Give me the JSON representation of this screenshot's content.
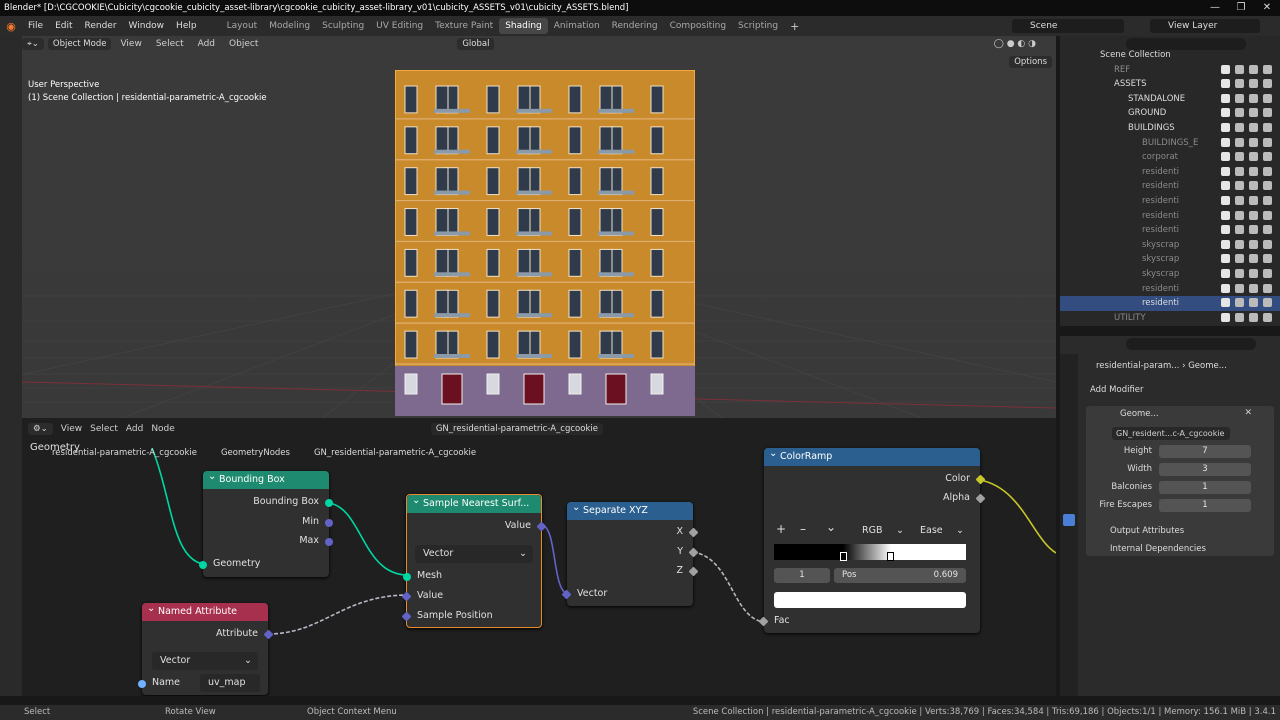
{
  "window": {
    "title": "Blender* [D:\\CGCOOKIE\\Cubicity\\cgcookie_cubicity_asset-library\\cgcookie_cubicity_asset-library_v01\\cubicity_ASSETS_v01\\cubicity_ASSETS.blend]",
    "controls": [
      "—",
      "❐",
      "✕"
    ]
  },
  "menubar": {
    "menus": [
      "File",
      "Edit",
      "Render",
      "Window",
      "Help"
    ],
    "workspaces": [
      "Layout",
      "Modeling",
      "Sculpting",
      "UV Editing",
      "Texture Paint",
      "Shading",
      "Animation",
      "Rendering",
      "Compositing",
      "Scripting"
    ],
    "active_workspace": "Shading",
    "add_tab": "+",
    "scene": "Scene",
    "view_layer": "View Layer"
  },
  "viewport": {
    "mode": "Object Mode",
    "menus": [
      "View",
      "Select",
      "Add",
      "Object"
    ],
    "transform": "Global",
    "options": "Options",
    "perspective": "User Perspective",
    "collection_info": "(1) Scene Collection | residential-parametric-A_cgcookie",
    "building": {
      "floors": 7,
      "columns": 7,
      "facade_color": "#c98a2c",
      "base_color": "#7e6a8e"
    }
  },
  "node_editor": {
    "menus": [
      "View",
      "Select",
      "Add",
      "Node"
    ],
    "node_group": "GN_residential-parametric-A_cgcookie",
    "breadcrumb": [
      "residential-parametric-A_cgcookie",
      "GeometryNodes",
      "GN_residential-parametric-A_cgcookie"
    ],
    "overlay_label": "Geometry",
    "nodes": {
      "bounding_box": {
        "title": "Bounding Box",
        "outputs": [
          "Bounding Box",
          "Min",
          "Max"
        ],
        "input": "Geometry",
        "color": "#1e8a6f"
      },
      "sample_nearest": {
        "title": "Sample Nearest Surf...",
        "output": "Value",
        "dropdown": "Vector",
        "inputs": [
          "Mesh",
          "Value",
          "Sample Position"
        ],
        "color": "#1e8a6f"
      },
      "separate_xyz": {
        "title": "Separate XYZ",
        "outputs": [
          "X",
          "Y",
          "Z"
        ],
        "input": "Vector",
        "color": "#2b5f8f"
      },
      "color_ramp": {
        "title": "ColorRamp",
        "outputs": [
          "Color",
          "Alpha"
        ],
        "add": "+",
        "remove": "–",
        "menu": "⌄",
        "mode": "RGB",
        "interp": "Ease",
        "stop_index": "1",
        "pos_label": "Pos",
        "pos_value": "0.609",
        "input": "Fac",
        "color": "#2b5f8f"
      },
      "named_attribute": {
        "title": "Named Attribute",
        "output": "Attribute",
        "dropdown": "Vector",
        "name_label": "Name",
        "name_value": "uv_map",
        "color": "#a8304f"
      }
    }
  },
  "outliner": {
    "search_placeholder": "",
    "items": [
      {
        "name": "Scene Collection",
        "indent": 0,
        "dim": false,
        "sel": false
      },
      {
        "name": "REF",
        "indent": 1,
        "dim": true,
        "sel": false
      },
      {
        "name": "ASSETS",
        "indent": 1,
        "dim": false,
        "sel": false
      },
      {
        "name": "STANDALONE",
        "indent": 2,
        "dim": false,
        "sel": false
      },
      {
        "name": "GROUND",
        "indent": 2,
        "dim": false,
        "sel": false
      },
      {
        "name": "BUILDINGS",
        "indent": 2,
        "dim": false,
        "sel": false
      },
      {
        "name": "BUILDINGS_E",
        "indent": 3,
        "dim": true,
        "sel": false
      },
      {
        "name": "corporat",
        "indent": 3,
        "dim": true,
        "sel": false
      },
      {
        "name": "residenti",
        "indent": 3,
        "dim": true,
        "sel": false
      },
      {
        "name": "residenti",
        "indent": 3,
        "dim": true,
        "sel": false
      },
      {
        "name": "residenti",
        "indent": 3,
        "dim": true,
        "sel": false
      },
      {
        "name": "residenti",
        "indent": 3,
        "dim": true,
        "sel": false
      },
      {
        "name": "residenti",
        "indent": 3,
        "dim": true,
        "sel": false
      },
      {
        "name": "skyscrap",
        "indent": 3,
        "dim": true,
        "sel": false
      },
      {
        "name": "skyscrap",
        "indent": 3,
        "dim": true,
        "sel": false
      },
      {
        "name": "skyscrap",
        "indent": 3,
        "dim": true,
        "sel": false
      },
      {
        "name": "residenti",
        "indent": 3,
        "dim": true,
        "sel": false
      },
      {
        "name": "residenti",
        "indent": 3,
        "dim": false,
        "sel": true
      },
      {
        "name": "UTILITY",
        "indent": 1,
        "dim": true,
        "sel": false
      }
    ]
  },
  "properties": {
    "breadcrumb_object": "residential-param...",
    "breadcrumb_modifier": "Geome...",
    "add_modifier": "Add Modifier",
    "modifier_name": "Geome...",
    "node_group": "GN_resident...c-A_cgcookie",
    "fields": [
      {
        "label": "Height",
        "value": "7"
      },
      {
        "label": "Width",
        "value": "3"
      },
      {
        "label": "Balconies",
        "value": "1"
      },
      {
        "label": "Fire Escapes",
        "value": "1"
      }
    ],
    "panels": [
      "Output Attributes",
      "Internal Dependencies"
    ]
  },
  "statusbar": {
    "select": "Select",
    "rotate": "Rotate View",
    "context": "Object Context Menu",
    "stats": "Scene Collection | residential-parametric-A_cgcookie | Verts:38,769 | Faces:34,584 | Tris:69,186 | Objects:1/1 | Memory: 156.1 MiB | 3.4.1"
  }
}
